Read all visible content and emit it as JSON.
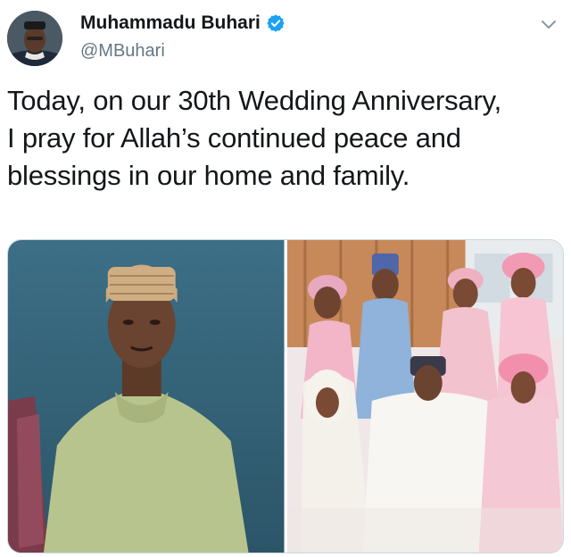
{
  "user": {
    "display_name": "Muhammadu Buhari",
    "handle": "@MBuhari",
    "verified": true,
    "avatar_icon": "profile-photo"
  },
  "tweet": {
    "text": "Today, on our 30th Wedding Anniversary,\nI pray for Allah’s continued peace and\nblessings in our home and family."
  },
  "icons": {
    "verified": "verified-badge-icon",
    "menu": "chevron-down-icon"
  },
  "media": {
    "photos": [
      {
        "description_name": "vintage-portrait-photo"
      },
      {
        "description_name": "family-group-photo"
      }
    ]
  },
  "colors": {
    "verified_blue": "#1da1f2",
    "text_primary": "#14171a",
    "text_secondary": "#657786"
  }
}
